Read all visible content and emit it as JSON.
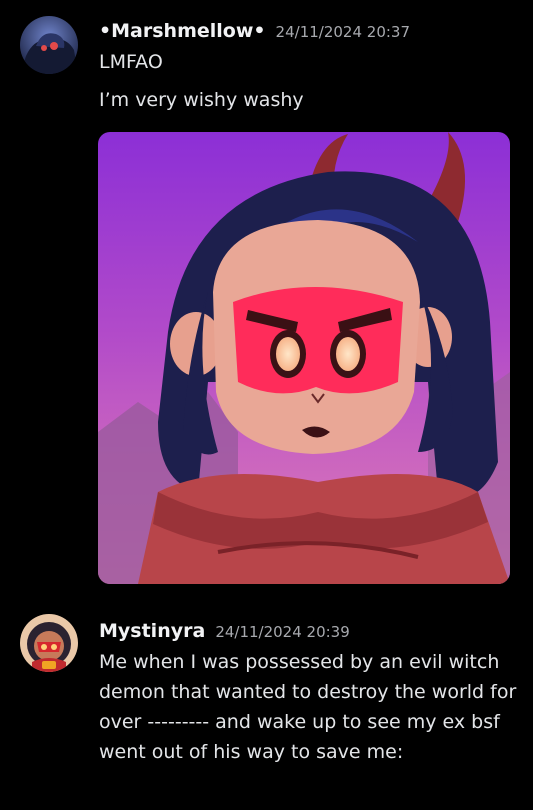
{
  "messages": [
    {
      "username": "•Marshmellow•",
      "timestamp": "24/11/2024 20:37",
      "lines": [
        "LMFAO",
        "I’m very wishy washy"
      ],
      "attachment": {
        "type": "image",
        "subject": "anime-character-glowing-eyes"
      }
    },
    {
      "username": "Mystinyra",
      "timestamp": "24/11/2024 20:39",
      "text": "Me when I was possessed by an evil witch demon that wanted to destroy the world for over --------- and wake up to see my ex bsf went out of his way to save me:"
    }
  ],
  "colors": {
    "background": "#000000",
    "username": "#f2f3f5",
    "timestamp": "#a7a9ae",
    "message_text": "#e3e5e8"
  }
}
